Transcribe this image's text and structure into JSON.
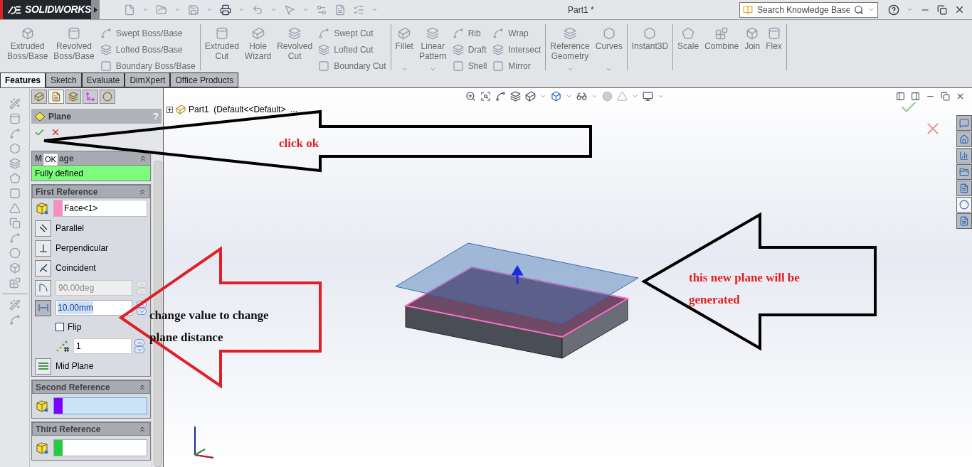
{
  "app": {
    "logo": "SOLIDWORKS",
    "document_title": "Part1 *",
    "search": {
      "placeholder": "Search Knowledge Base"
    }
  },
  "ribbon": {
    "groups": [
      {
        "items": [
          {
            "kind": "large",
            "label": "Extruded Boss/Base",
            "dropdown": false
          },
          {
            "kind": "large",
            "label": "Revolved Boss/Base",
            "dropdown": false
          },
          {
            "kind": "stack",
            "items": [
              "Swept Boss/Base",
              "Lofted Boss/Base",
              "Boundary Boss/Base"
            ]
          }
        ]
      },
      {
        "items": [
          {
            "kind": "large",
            "label": "Extruded Cut",
            "dropdown": false
          },
          {
            "kind": "large",
            "label": "Hole Wizard",
            "dropdown": false
          },
          {
            "kind": "large",
            "label": "Revolved Cut",
            "dropdown": false
          },
          {
            "kind": "stack",
            "items": [
              "Swept Cut",
              "Lofted Cut",
              "Boundary Cut"
            ]
          }
        ]
      },
      {
        "items": [
          {
            "kind": "large",
            "label": "Fillet",
            "dropdown": true
          },
          {
            "kind": "large",
            "label": "Linear Pattern",
            "dropdown": true
          },
          {
            "kind": "stack",
            "items": [
              "Rib",
              "Draft",
              "Shell"
            ]
          },
          {
            "kind": "stack",
            "items": [
              "Wrap",
              "Intersect",
              "Mirror"
            ]
          }
        ]
      },
      {
        "items": [
          {
            "kind": "large",
            "label": "Reference Geometry",
            "dropdown": true
          },
          {
            "kind": "large",
            "label": "Curves",
            "dropdown": true
          }
        ]
      },
      {
        "items": [
          {
            "kind": "large",
            "label": "Instant3D",
            "dropdown": false
          }
        ]
      },
      {
        "items": [
          {
            "kind": "large",
            "label": "Scale",
            "dropdown": false
          },
          {
            "kind": "large",
            "label": "Combine",
            "dropdown": false
          },
          {
            "kind": "large",
            "label": "Join",
            "dropdown": false
          },
          {
            "kind": "large",
            "label": "Flex",
            "dropdown": false
          }
        ]
      }
    ]
  },
  "tabs": [
    {
      "label": "Features",
      "selected": true
    },
    {
      "label": "Sketch",
      "selected": false
    },
    {
      "label": "Evaluate",
      "selected": false
    },
    {
      "label": "DimXpert",
      "selected": false
    },
    {
      "label": "Office Products",
      "selected": false
    }
  ],
  "feature_tree": {
    "root": "Part1",
    "configuration": "(Default<<Default>_..."
  },
  "property_manager": {
    "tabs": [
      {
        "selected": false
      },
      {
        "selected": true
      },
      {
        "selected": false
      },
      {
        "selected": false
      },
      {
        "selected": false
      }
    ],
    "title": "Plane",
    "help": "?",
    "message": {
      "title_start": "M",
      "title_end": "age",
      "text": "Fully defined"
    },
    "tooltip": "OK",
    "first_reference": {
      "title": "First Reference",
      "selection": "Face<1>",
      "color": "#f58cc4",
      "constraints": [
        {
          "label": "Parallel",
          "selected": false
        },
        {
          "label": "Perpendicular",
          "selected": false
        },
        {
          "label": "Coincident",
          "selected": false
        }
      ],
      "angle": {
        "value": "90.00deg",
        "disabled": true
      },
      "distance": {
        "value": "10.00mm",
        "selected": true
      },
      "flip": {
        "label": "Flip",
        "checked": false
      },
      "count": "1",
      "mid_plane": {
        "label": "Mid Plane",
        "selected": false
      }
    },
    "second_reference": {
      "title": "Second Reference",
      "color": "#8000ff",
      "active": true
    },
    "third_reference": {
      "title": "Third Reference",
      "color": "#22cc44",
      "active": false
    }
  },
  "task_pane": {
    "tabs": [
      {
        "selected": false
      },
      {
        "selected": false
      },
      {
        "selected": false
      },
      {
        "selected": false
      },
      {
        "selected": false
      },
      {
        "selected": true
      },
      {
        "selected": false
      }
    ]
  },
  "annotations": [
    {
      "text": "click ok",
      "color": "#e02020"
    },
    {
      "text": "change value to change plane distance",
      "color": "#111111"
    },
    {
      "text": "this new plane will be generated",
      "color": "#e02020"
    }
  ]
}
